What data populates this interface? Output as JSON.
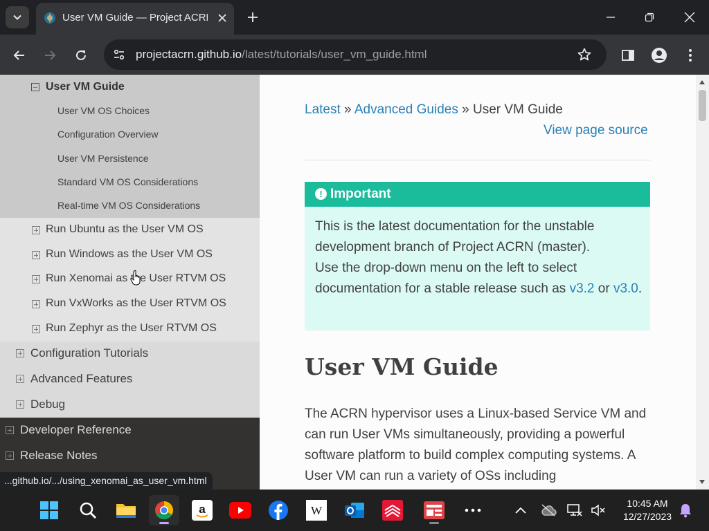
{
  "browser": {
    "tab_title": "User VM Guide — Project ACRN",
    "url_host": "projectacrn.github.io",
    "url_path": "/latest/tutorials/user_vm_guide.html",
    "status_url": "...github.io/.../using_xenomai_as_user_vm.html"
  },
  "sidebar": {
    "current_page": "User VM Guide",
    "subsections": [
      "User VM OS Choices",
      "Configuration Overview",
      "User VM Persistence",
      "Standard VM OS Considerations",
      "Real-time VM OS Considerations"
    ],
    "tutorials": [
      "Run Ubuntu as the User VM OS",
      "Run Windows as the User VM OS",
      "Run Xenomai as the User RTVM OS",
      "Run VxWorks as the User RTVM OS",
      "Run Zephyr as the User RTVM OS"
    ],
    "sections": [
      "Configuration Tutorials",
      "Advanced Features",
      "Debug"
    ],
    "top_level": [
      "Developer Reference",
      "Release Notes"
    ]
  },
  "content": {
    "breadcrumb": {
      "latest": "Latest",
      "sep1": " » ",
      "advanced": "Advanced Guides",
      "sep2": " » ",
      "current": "User VM Guide"
    },
    "view_source": "View page source",
    "admonition": {
      "title": "Important",
      "text1": "This is the latest documentation for the unstable development branch of Project ACRN (master).",
      "text2": "Use the drop-down menu on the left to select documentation for a stable release such as ",
      "link1": "v3.2",
      "text3": " or ",
      "link2": "v3.0",
      "text4": "."
    },
    "heading": "User VM Guide",
    "paragraph": "The ACRN hypervisor uses a Linux-based Service VM and can run User VMs simultaneously, providing a powerful software platform to build complex computing systems. A User VM can run a variety of OSs including"
  },
  "taskbar": {
    "time": "10:45 AM",
    "date": "12/27/2023",
    "apps": [
      "start",
      "search",
      "file-explorer",
      "chrome",
      "amazon",
      "youtube",
      "facebook",
      "wikipedia",
      "outlook",
      "bank",
      "news",
      "more"
    ]
  },
  "colors": {
    "link": "#2980b9",
    "admonition_header": "#1abc9c",
    "admonition_body": "#dbfaf4",
    "sidebar_dark": "#343131"
  }
}
